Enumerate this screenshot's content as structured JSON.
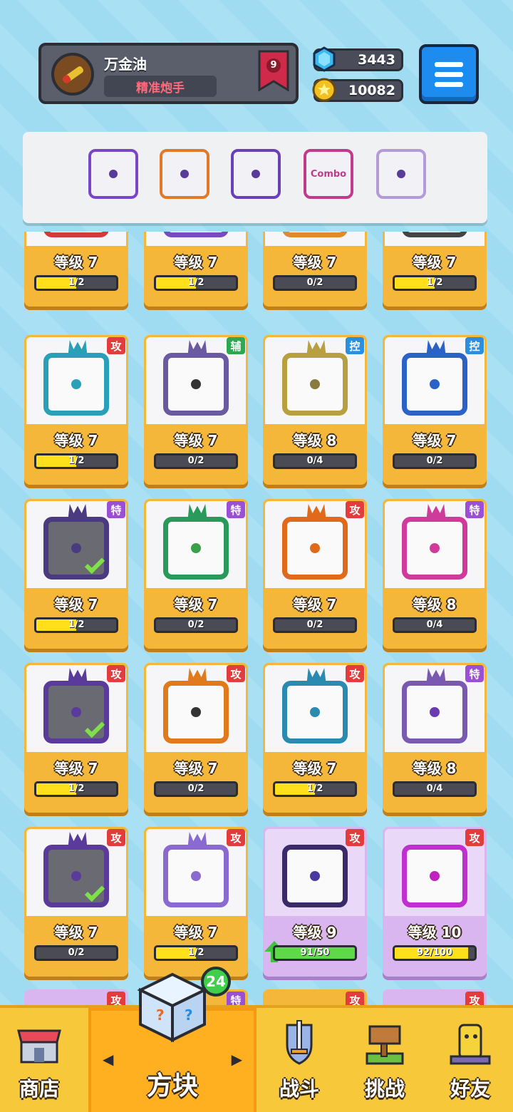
{
  "player": {
    "name": "万金油",
    "title": "精准炮手",
    "rank": "9"
  },
  "currency": {
    "gems": "3443",
    "coins": "10082"
  },
  "deck": [
    {
      "label": "",
      "color": "#7a46c8"
    },
    {
      "label": "",
      "color": "#e07a2a"
    },
    {
      "label": "",
      "color": "#6a3fb8"
    },
    {
      "label": "Combo",
      "color": "#c23a8c"
    },
    {
      "label": "",
      "color": "#b49ad8"
    }
  ],
  "cards": [
    {
      "level": "等级 7",
      "progress": "1/2",
      "fill": 0.5,
      "type": "",
      "color": "#d33a3a",
      "dot": "#333",
      "check": false,
      "partial": true
    },
    {
      "level": "等级 7",
      "progress": "1/2",
      "fill": 0.5,
      "type": "",
      "color": "#7a4ac0",
      "dot": "#333",
      "check": false,
      "partial": true
    },
    {
      "level": "等级 7",
      "progress": "0/2",
      "fill": 0,
      "type": "",
      "color": "#e08a2a",
      "dot": "#333",
      "check": false,
      "partial": true
    },
    {
      "level": "等级 7",
      "progress": "1/2",
      "fill": 0.5,
      "type": "",
      "color": "#444",
      "dot": "#333",
      "check": true,
      "partial": true
    },
    {
      "level": "等级 7",
      "progress": "1/2",
      "fill": 0.5,
      "type": "攻",
      "typeClass": "atk",
      "color": "#2aa0b8",
      "dot": "#2aa0b8",
      "check": false
    },
    {
      "level": "等级 7",
      "progress": "0/2",
      "fill": 0,
      "type": "辅",
      "typeClass": "sup",
      "color": "#6a5aa0",
      "dot": "#333",
      "check": false
    },
    {
      "level": "等级 8",
      "progress": "0/4",
      "fill": 0,
      "type": "控",
      "typeClass": "ctl",
      "color": "#b8a040",
      "dot": "#8a7a40",
      "check": false
    },
    {
      "level": "等级 7",
      "progress": "0/2",
      "fill": 0,
      "type": "控",
      "typeClass": "ctl",
      "color": "#2a62c8",
      "dot": "#2a62c8",
      "check": false
    },
    {
      "level": "等级 7",
      "progress": "1/2",
      "fill": 0.5,
      "type": "特",
      "typeClass": "spc",
      "color": "#4a3a80",
      "dot": "#4a3a80",
      "check": true,
      "dark": true
    },
    {
      "level": "等级 7",
      "progress": "0/2",
      "fill": 0,
      "type": "特",
      "typeClass": "spc",
      "color": "#2a9a5a",
      "dot": "#3aa04a",
      "check": false
    },
    {
      "level": "等级 7",
      "progress": "0/2",
      "fill": 0,
      "type": "攻",
      "typeClass": "atk",
      "color": "#e06a1a",
      "dot": "#e06a1a",
      "check": false
    },
    {
      "level": "等级 8",
      "progress": "0/4",
      "fill": 0,
      "type": "特",
      "typeClass": "spc",
      "color": "#d03a9a",
      "dot": "#d03a9a",
      "check": false
    },
    {
      "level": "等级 7",
      "progress": "1/2",
      "fill": 0.5,
      "type": "攻",
      "typeClass": "atk",
      "color": "#5a3a9a",
      "dot": "#5a3a9a",
      "check": true,
      "dark": true
    },
    {
      "level": "等级 7",
      "progress": "0/2",
      "fill": 0,
      "type": "攻",
      "typeClass": "atk",
      "color": "#e07a1a",
      "dot": "#333",
      "check": false
    },
    {
      "level": "等级 7",
      "progress": "1/2",
      "fill": 0.5,
      "type": "攻",
      "typeClass": "atk",
      "color": "#2a8ab0",
      "dot": "#2a8ab0",
      "check": false
    },
    {
      "level": "等级 8",
      "progress": "0/4",
      "fill": 0,
      "type": "特",
      "typeClass": "spc",
      "color": "#7a5ab0",
      "dot": "#6a3ab0",
      "check": false
    },
    {
      "level": "等级 7",
      "progress": "0/2",
      "fill": 0,
      "type": "攻",
      "typeClass": "atk",
      "color": "#5a3a9a",
      "dot": "#5a3a9a",
      "check": true,
      "dark": true
    },
    {
      "level": "等级 7",
      "progress": "1/2",
      "fill": 0.5,
      "type": "攻",
      "typeClass": "atk",
      "color": "#8a6ad0",
      "dot": "#8a6ad0",
      "check": false
    },
    {
      "level": "等级 9",
      "progress": "91/50",
      "fill": 1,
      "type": "攻",
      "typeClass": "atk",
      "color": "#3a2a6a",
      "dot": "#4a3aa0",
      "check": false,
      "purple": true,
      "upgrade": true
    },
    {
      "level": "等级 10",
      "progress": "92/100",
      "fill": 0.92,
      "type": "攻",
      "typeClass": "atk",
      "color": "#c030d0",
      "dot": "#c020c0",
      "check": false,
      "purple": true
    }
  ],
  "next_row_types": [
    {
      "type": "攻",
      "typeClass": "atk"
    },
    {
      "type": "特",
      "typeClass": "spc"
    },
    {
      "type": "攻",
      "typeClass": "atk"
    },
    {
      "type": "攻",
      "typeClass": "atk"
    }
  ],
  "nav": {
    "shop": "商店",
    "blocks": "方块",
    "blocks_badge": "24",
    "battle": "战斗",
    "challenge": "挑战",
    "friends": "好友"
  }
}
